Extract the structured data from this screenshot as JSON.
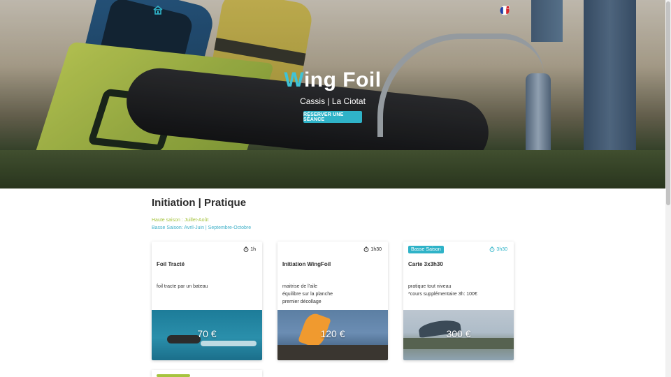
{
  "hero": {
    "title_first_letter": "W",
    "title_rest": "ing Foil",
    "subtitle": "Cassis | La Ciotat",
    "cta_label": "RÉSERVER UNE SÉANCE"
  },
  "nav": {
    "home_icon": "home-icon",
    "language_icon": "french-flag-icon"
  },
  "section": {
    "title": "Initiation | Pratique",
    "season_high": "Haute saison : Juillet-Août",
    "season_low": "Basse Saison: Avril-Juin | Septembre-Octobre"
  },
  "cards": [
    {
      "badge": "",
      "duration": "1h",
      "title": "Foil Tracté",
      "desc_lines": [
        "foil tracte par un bateau"
      ],
      "price": "70 €"
    },
    {
      "badge": "",
      "duration": "1h30",
      "title": "Initiation WingFoil",
      "desc_lines": [
        "maitrise de l'aile",
        "équilibre sur la planche",
        "premier décollage"
      ],
      "price": "120 €"
    },
    {
      "badge": "Basse Saison",
      "duration": "3h30",
      "title": "Carte 3x3h30",
      "desc_lines": [
        "pratique tout niveau",
        "*cours supplémentaire 3h: 100€"
      ],
      "price": "300 €"
    }
  ],
  "colors": {
    "accent": "#2fb3c8",
    "season_high": "#a6c43f"
  }
}
